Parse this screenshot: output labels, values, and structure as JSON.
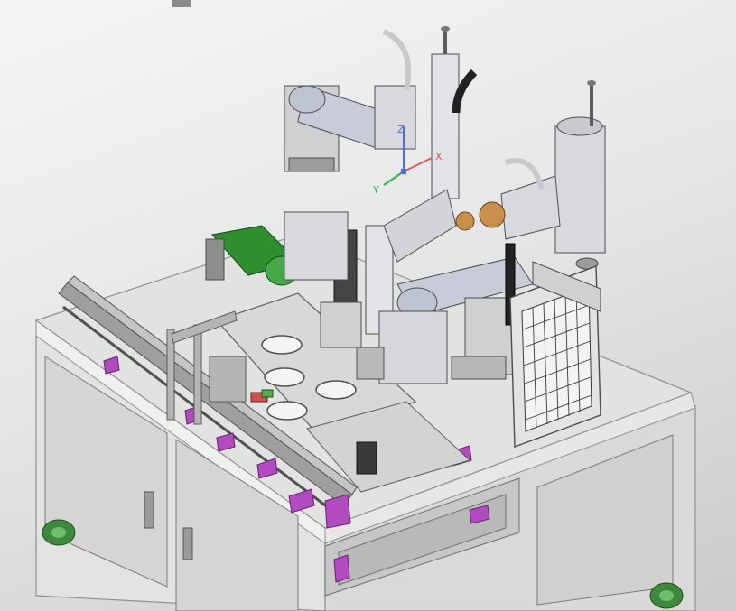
{
  "viewport": {
    "background_top": "#f4f5f5",
    "background_bottom": "#c9cccb"
  },
  "colors": {
    "frame": "#e6e7e5",
    "frame_shadow": "#b7b9b7",
    "cabinet_door": "#cfd0ce",
    "table_top": "#dcdedc",
    "robot_body": "#d8d9dc",
    "robot_arm": "#c7ccd8",
    "motor_green": "#2f8f2f",
    "fixture_magenta": "#b14bbf",
    "caster_green": "#3d8a3d",
    "cable_black": "#222222",
    "copper": "#c9904a"
  },
  "axis_triad": {
    "x_label": "X",
    "y_label": "Y",
    "z_label": "Z",
    "x_color": "#e05a5a",
    "y_color": "#2fb34a",
    "z_color": "#4a6fe0"
  },
  "components": [
    {
      "name": "scara-robot-left",
      "icon": "scara-robot-icon"
    },
    {
      "name": "scara-robot-right",
      "icon": "scara-robot-icon"
    },
    {
      "name": "scara-robot-front",
      "icon": "scara-robot-icon"
    },
    {
      "name": "servo-motor-green",
      "icon": "motor-icon"
    },
    {
      "name": "safety-guard-mesh",
      "icon": "mesh-guard-icon"
    },
    {
      "name": "conveyor-rail",
      "icon": "conveyor-icon"
    },
    {
      "name": "work-plate",
      "icon": "plate-icon"
    },
    {
      "name": "cabinet-doors",
      "icon": "door-icon"
    },
    {
      "name": "caster-wheels",
      "icon": "wheel-icon"
    }
  ]
}
